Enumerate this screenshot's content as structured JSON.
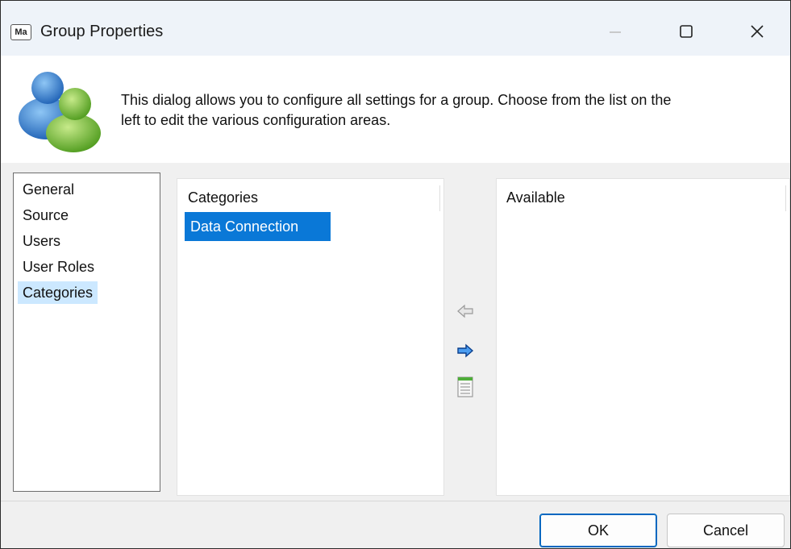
{
  "window": {
    "title": "Group Properties",
    "app_icon_text": "Ma"
  },
  "header": {
    "description": "This dialog allows you to configure all settings for a group.  Choose from the list on the\nleft to edit the various configuration areas."
  },
  "nav": {
    "items": [
      {
        "label": "General"
      },
      {
        "label": "Source"
      },
      {
        "label": "Users"
      },
      {
        "label": "User Roles"
      },
      {
        "label": "Categories",
        "selected": true
      }
    ]
  },
  "categories_list": {
    "header": "Categories",
    "rows": [
      {
        "label": "Data Connection",
        "selected": true
      }
    ]
  },
  "available_list": {
    "header": "Available",
    "rows": []
  },
  "transfer_icons": [
    "arrow-left-icon",
    "arrow-right-icon",
    "list-document-icon"
  ],
  "buttons": {
    "ok": "OK",
    "cancel": "Cancel"
  },
  "colors": {
    "selection_blue": "#0a78d7",
    "nav_selection": "#cce8ff",
    "arrow_blue": "#1e6fd9"
  }
}
